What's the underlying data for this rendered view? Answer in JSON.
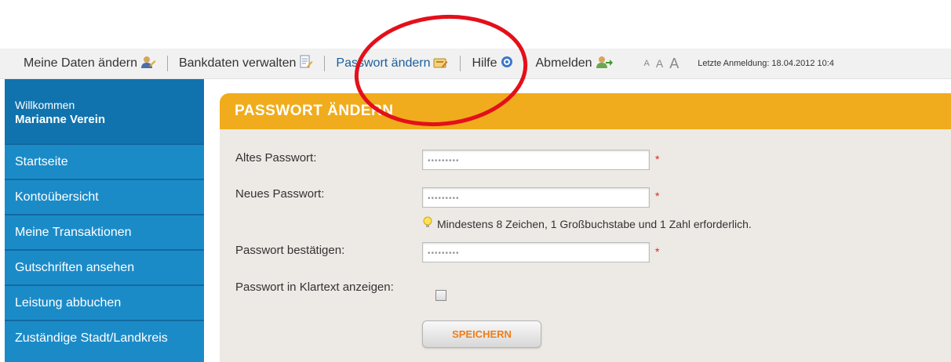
{
  "nav": {
    "items": [
      {
        "label": "Meine Daten ändern",
        "icon": "user-edit-icon"
      },
      {
        "label": "Bankdaten verwalten",
        "icon": "document-edit-icon"
      },
      {
        "label": "Passwort ändern",
        "icon": "password-edit-icon"
      },
      {
        "label": "Hilfe",
        "icon": "help-icon"
      },
      {
        "label": "Abmelden",
        "icon": "logout-icon"
      }
    ],
    "text_sizes": [
      "A",
      "A",
      "A"
    ],
    "last_login": "Letzte Anmeldung: 18.04.2012 10:4"
  },
  "sidebar": {
    "welcome": "Willkommen",
    "user": "Marianne Verein",
    "items": [
      {
        "label": "Startseite"
      },
      {
        "label": "Kontoübersicht"
      },
      {
        "label": "Meine Transaktionen"
      },
      {
        "label": "Gutschriften ansehen"
      },
      {
        "label": "Leistung abbuchen"
      },
      {
        "label": "Zuständige Stadt/Landkreis"
      }
    ]
  },
  "form": {
    "title": "PASSWORT ÄNDERN",
    "old_label": "Altes Passwort:",
    "old_value": "•••••••••",
    "new_label": "Neues Passwort:",
    "new_value": "•••••••••",
    "hint": "Mindestens 8 Zeichen, 1 Großbuchstabe und 1 Zahl erforderlich.",
    "confirm_label": "Passwort bestätigen:",
    "confirm_value": "•••••••••",
    "show_label": "Passwort in Klartext anzeigen:",
    "required_mark": "*",
    "save_label": "SPEICHERN"
  },
  "colors": {
    "sidebar": "#1b8bc8",
    "sidebar_header": "#1173ad",
    "panel_header": "#f0ac1c",
    "panel_bg": "#ede9e5",
    "annotation": "#e3101a",
    "save_text": "#ef7d1a"
  }
}
